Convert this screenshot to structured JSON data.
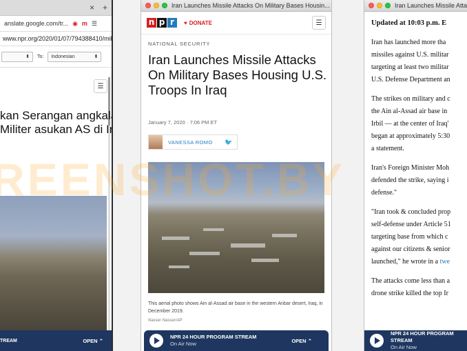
{
  "panel1": {
    "tab_close": "×",
    "tab_new": "+",
    "url_translate": "anslate.google.com/tr...",
    "url_site": "www.npr.org/2020/01/07/794388410/milit",
    "to_label": "To:",
    "to_value": "Indonesian",
    "headline": "kan Serangan angkalan Militer asukan AS di Irak",
    "stream": "TREAM",
    "open": "OPEN"
  },
  "panel2": {
    "window_title": "Iran Launches Missile Attacks On Military Bases Housin...",
    "logo": [
      "n",
      "p",
      "r"
    ],
    "donate": "DONATE",
    "kicker": "NATIONAL SECURITY",
    "headline": "Iran Launches Missile Attacks On Military Bases Housing U.S. Troops In Iraq",
    "date": "January 7, 2020 · 7:06 PM ET",
    "author": "VANESSA ROMO",
    "caption": "This aerial photo shows Ain al-Assad air base in the western Anbar desert, Iraq, in December 2019.",
    "credit": "Nasser Nasser/AP",
    "stream_title": "NPR 24 HOUR PROGRAM STREAM",
    "stream_sub": "On Air Now",
    "open": "OPEN"
  },
  "panel3": {
    "window_title": "Iran Launches Missile Atta",
    "updated": "Updated at 10:03 p.m. E",
    "p1": [
      "Iran has launched more tha",
      "missiles against U.S. militar",
      "targeting at least two militar",
      "U.S. Defense Department an"
    ],
    "p2": [
      "The strikes on military and c",
      "the Ain al-Assad air base in",
      "Irbil — at the center of Iraq'",
      "began at approximately 5:30",
      "a statement."
    ],
    "p3": [
      "Iran's Foreign Minister Moh",
      "defended the strike, saying i",
      "defense.\""
    ],
    "p4_a": "\"Iran took & concluded prop",
    "p4_b": "self-defense under Article 51",
    "p4_c": "targeting base from which c",
    "p4_d": "against our citizens & senior",
    "p4_e_pre": "launched,\" he wrote in a ",
    "p4_e_link": "twe",
    "p5": [
      "The attacks come less than a",
      "drone strike killed the top Ir"
    ],
    "stream_title": "NPR 24 HOUR PROGRAM STREAM",
    "stream_sub": "On Air Now"
  },
  "watermark": "REENSHOT.BY",
  "colors": {
    "npr_red": "#d62021",
    "npr_blue": "#237bbd",
    "player_bg": "#1f3760"
  }
}
